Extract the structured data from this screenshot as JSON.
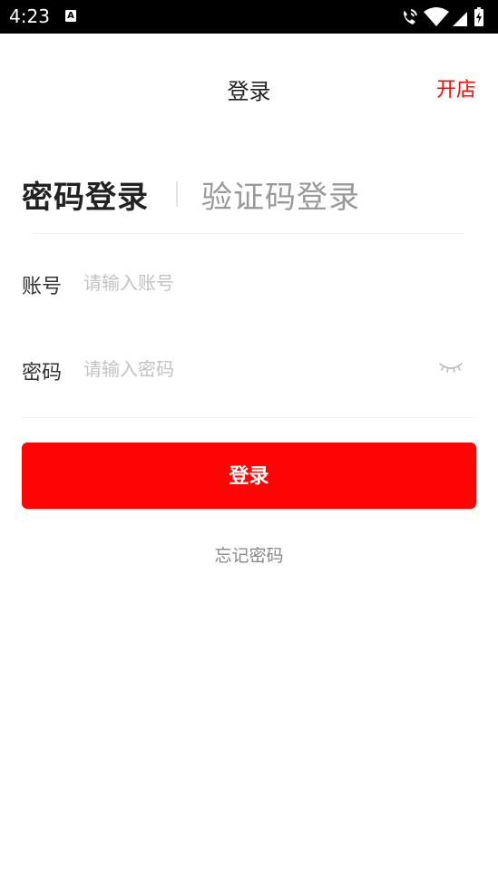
{
  "status_bar": {
    "time": "4:23",
    "a_icon_letter": "A",
    "icons": [
      "wifi-calling-icon",
      "wifi-icon",
      "signal-icon",
      "battery-charging-icon"
    ]
  },
  "header": {
    "title": "登录",
    "right_action": "开店"
  },
  "tabs": {
    "active": "密码登录",
    "inactive": "验证码登录"
  },
  "form": {
    "account": {
      "label": "账号",
      "placeholder": "请输入账号",
      "value": ""
    },
    "password": {
      "label": "密码",
      "placeholder": "请输入密码",
      "value": "",
      "visibility_icon": "eye-closed-icon"
    }
  },
  "login_button": "登录",
  "forgot_password": "忘记密码",
  "colors": {
    "accent": "#ff0404",
    "open_store": "#ff0a0a",
    "placeholder": "#c2c2c2"
  }
}
